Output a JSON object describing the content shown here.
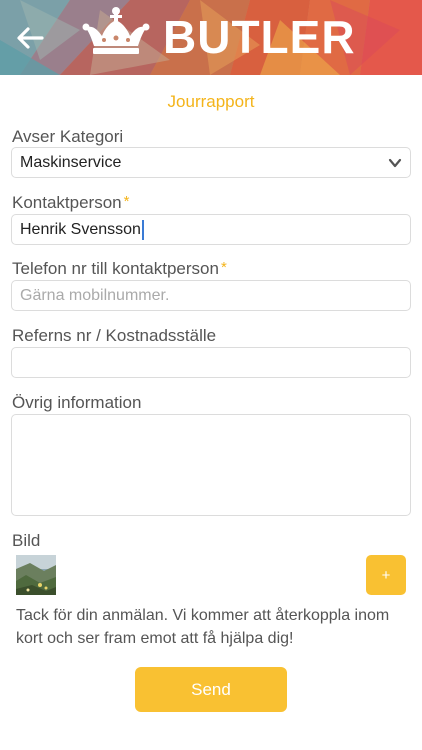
{
  "header": {
    "logo_text": "BUTLER",
    "back_icon": "arrow-left-icon",
    "crown_icon": "crown-icon"
  },
  "subtitle": "Jourrapport",
  "form": {
    "category": {
      "label": "Avser Kategori",
      "value": "Maskinservice"
    },
    "contact": {
      "label": "Kontaktperson",
      "required_mark": "*",
      "value": "Henrik Svensson"
    },
    "phone": {
      "label": "Telefon nr till kontaktperson",
      "required_mark": "*",
      "placeholder": "Gärna mobilnummer."
    },
    "reference": {
      "label": "Referns nr / Kostnadsställe",
      "value": ""
    },
    "other_info": {
      "label": "Övrig information",
      "value": ""
    },
    "image": {
      "label": "Bild",
      "add_label": "+"
    }
  },
  "thanks_message": "Tack för din anmälan. Vi kommer att återkoppla inom kort och ser fram emot att få hjälpa dig!",
  "send_label": "Send",
  "colors": {
    "accent": "#f9c132",
    "subtitle": "#f4b41a"
  }
}
